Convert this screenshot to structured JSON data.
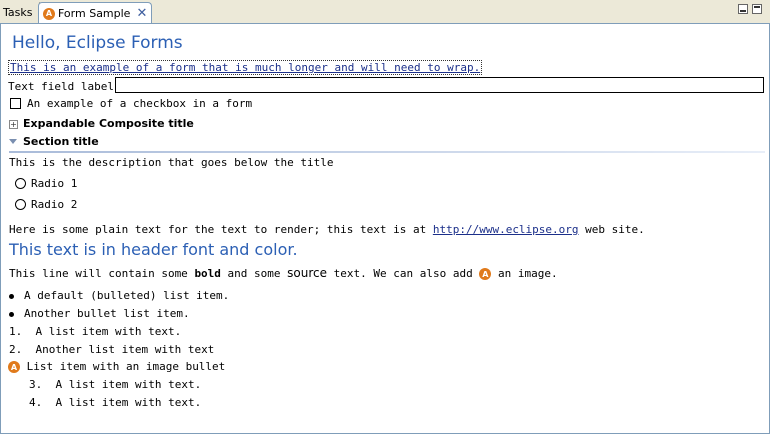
{
  "tabs": {
    "tasks_label": "Tasks",
    "form_label": "Form Sample",
    "close_glyph": "✕",
    "icon_letter": "A"
  },
  "form": {
    "title": "Hello, Eclipse Forms",
    "wrap_text": "This is an example of a form that is much longer and will need to wrap.",
    "text_field_label": "Text field label:",
    "text_field_value": "",
    "checkbox_label": "An example of a checkbox in a form",
    "checkbox_checked": false,
    "expandable_title": "Expandable Composite title",
    "expand_glyph": "+",
    "section_title": "Section title",
    "section_description": "This is the description that goes below the title",
    "radio1_label": "Radio 1",
    "radio2_label": "Radio 2"
  },
  "rich_text": {
    "plain_prefix": "Here is some plain text for the text to render; this text is at ",
    "link_text": "http://www.eclipse.org",
    "plain_suffix": " web site.",
    "header_text": "This text is in header font and color.",
    "line_part1": "This line will contain some ",
    "bold_word": "bold",
    "line_part2": " and some ",
    "source_word": "source",
    "line_part3": " text. We can also add ",
    "line_part4": " an image."
  },
  "list_items": {
    "bullet1": "A default (bulleted) list item.",
    "bullet2": "Another bullet list item.",
    "num1_marker": "1.",
    "num1": "A list item with text.",
    "num2_marker": "2.",
    "num2": "Another list item with text",
    "image_bullet": "List item with an image bullet",
    "num3_marker": "3.",
    "num3": "A list item with text.",
    "num4_marker": "4.",
    "num4": "A list item with text."
  },
  "colors": {
    "title_blue": "#2b5fb4",
    "link_blue": "#1b2f8a",
    "icon_orange": "#e07a1b"
  }
}
